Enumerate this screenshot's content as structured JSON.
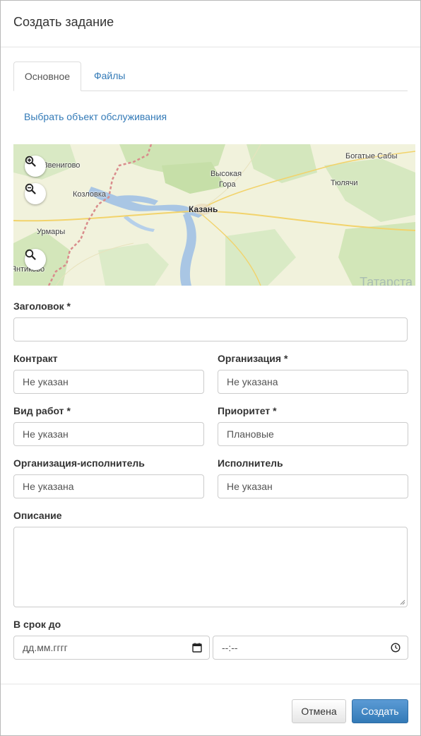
{
  "modal": {
    "title": "Создать задание"
  },
  "tabs": [
    {
      "label": "Основное",
      "active": true
    },
    {
      "label": "Файлы",
      "active": false
    }
  ],
  "select_object_link": "Выбрать объект обслуживания",
  "map": {
    "labels": {
      "zvenigovo": "Звенигово",
      "kozlovka": "Козловка",
      "urmary": "Урмары",
      "yantikovo": "Янтиково",
      "vysokaya_gora_1": "Высокая",
      "vysokaya_gora_2": "Гора",
      "kazan": "Казань",
      "bogatye_saby": "Богатые Сабы",
      "tyulyachi": "Тюлячи",
      "watermark": "Татарста"
    },
    "controls": [
      "zoom-in-icon",
      "zoom-out-icon",
      "search-icon"
    ]
  },
  "form": {
    "title_label": "Заголовок",
    "title_value": "",
    "contract_label": "Контракт",
    "contract_value": "Не указан",
    "organization_label": "Организация",
    "organization_value": "Не указана",
    "work_type_label": "Вид работ",
    "work_type_value": "Не указан",
    "priority_label": "Приоритет",
    "priority_value": "Плановые",
    "executor_org_label": "Организация-исполнитель",
    "executor_org_value": "Не указана",
    "executor_label": "Исполнитель",
    "executor_value": "Не указан",
    "description_label": "Описание",
    "description_value": "",
    "deadline_label": "В срок до",
    "date_placeholder": "дд.мм.гггг",
    "time_placeholder": "--:--",
    "required_mark": "*"
  },
  "footer": {
    "cancel_label": "Отмена",
    "create_label": "Создать"
  },
  "colors": {
    "link": "#337ab7",
    "primary": "#337ab7",
    "border": "#cccccc"
  }
}
